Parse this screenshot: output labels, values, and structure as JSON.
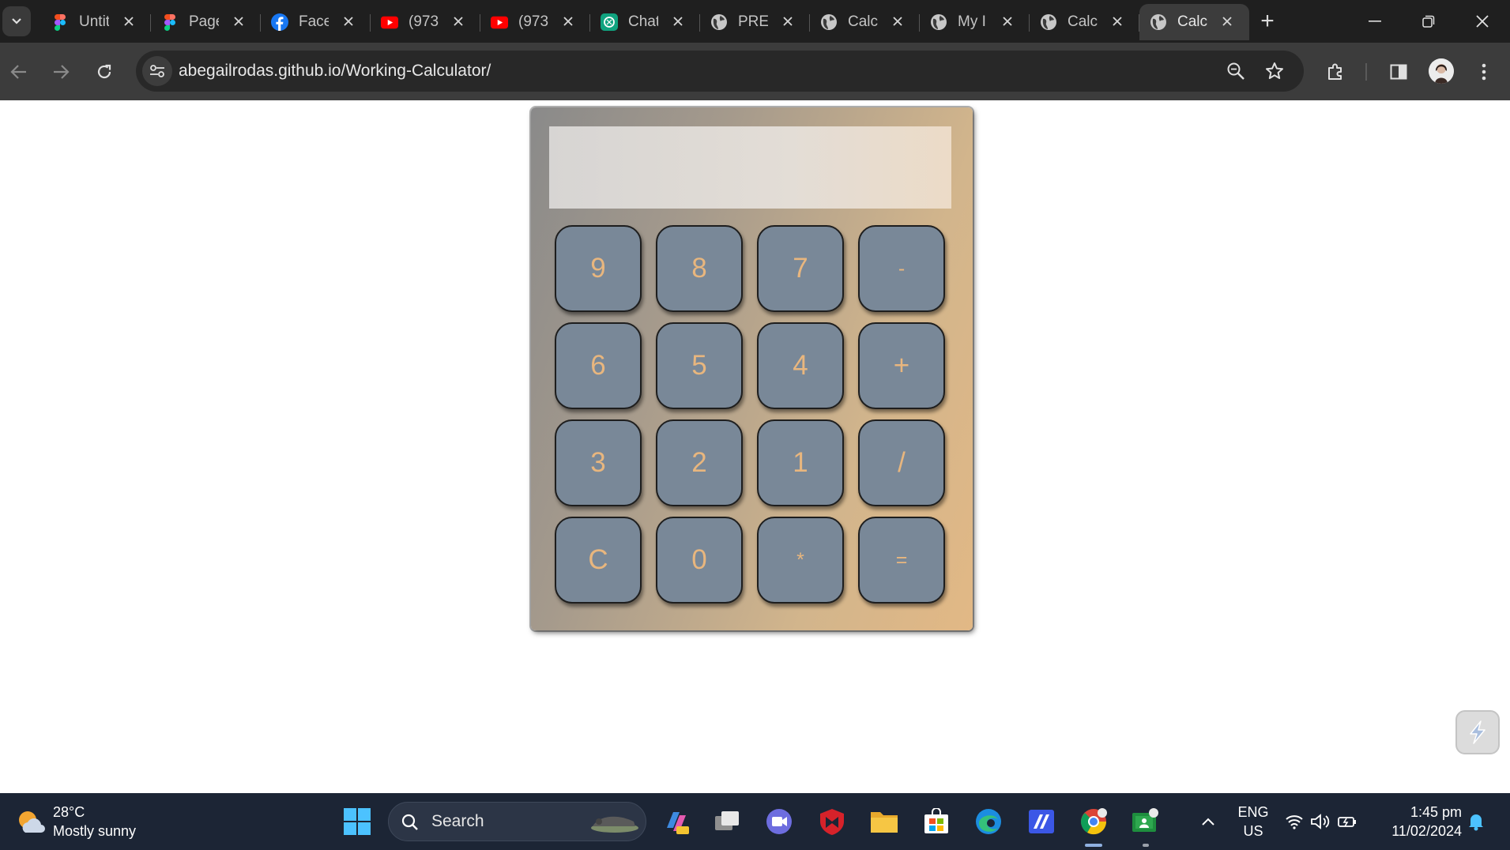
{
  "browser": {
    "tabs": [
      {
        "title": "Untitled",
        "icon": "figma-icon"
      },
      {
        "title": "Page",
        "icon": "figma-icon"
      },
      {
        "title": "Facebook",
        "icon": "facebook-icon"
      },
      {
        "title": "(973",
        "icon": "youtube-icon"
      },
      {
        "title": "(973",
        "icon": "youtube-icon"
      },
      {
        "title": "Chat",
        "icon": "chatgpt-icon"
      },
      {
        "title": "PREL",
        "icon": "globe-icon"
      },
      {
        "title": "Calc",
        "icon": "globe-icon"
      },
      {
        "title": "My I",
        "icon": "globe-icon"
      },
      {
        "title": "Calc",
        "icon": "globe-icon"
      },
      {
        "title": "Calc",
        "icon": "globe-icon",
        "active": true
      }
    ],
    "url": "abegailrodas.github.io/Working-Calculator/"
  },
  "calculator": {
    "display": "",
    "keys": [
      [
        "9",
        "8",
        "7",
        "-"
      ],
      [
        "6",
        "5",
        "4",
        "+"
      ],
      [
        "3",
        "2",
        "1",
        "/"
      ],
      [
        "C",
        "0",
        "*",
        "="
      ]
    ],
    "colors": {
      "key": "#798898",
      "key_text": "#e8b67e",
      "body_left": "#8a8a8a",
      "body_right": "#e2b885"
    }
  },
  "taskbar": {
    "weather": {
      "temp": "28°C",
      "desc": "Mostly sunny"
    },
    "search_label": "Search",
    "language": {
      "line1": "ENG",
      "line2": "US"
    },
    "clock": {
      "time": "1:45 pm",
      "date": "11/02/2024"
    }
  }
}
